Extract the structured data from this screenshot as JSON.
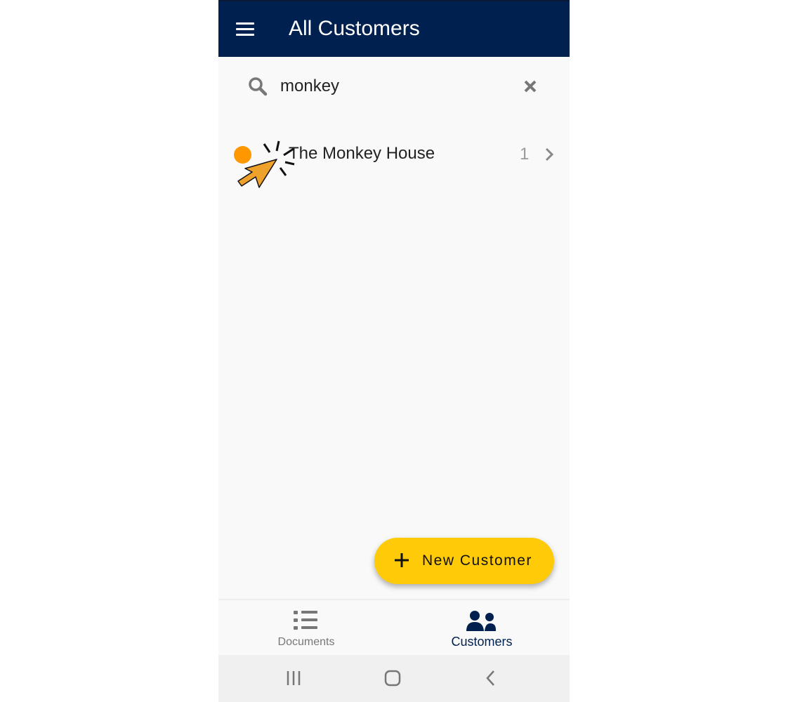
{
  "appbar": {
    "title": "All Customers",
    "menu_icon": "hamburger-menu-icon",
    "background": "#00204f"
  },
  "search": {
    "value": "monkey",
    "icon": "search-icon",
    "clear_icon": "close-icon"
  },
  "customers": [
    {
      "name": "The Monkey House",
      "count": "1",
      "status_color": "#ff9800"
    }
  ],
  "fab": {
    "label": "New Customer",
    "icon": "plus-icon",
    "color": "#ffca08"
  },
  "bottom_nav": {
    "items": [
      {
        "label": "Documents",
        "icon": "list-icon",
        "active": false
      },
      {
        "label": "Customers",
        "icon": "people-icon",
        "active": true
      }
    ]
  },
  "system_nav": {
    "items": [
      "recent-apps-icon",
      "home-icon",
      "back-icon"
    ]
  }
}
